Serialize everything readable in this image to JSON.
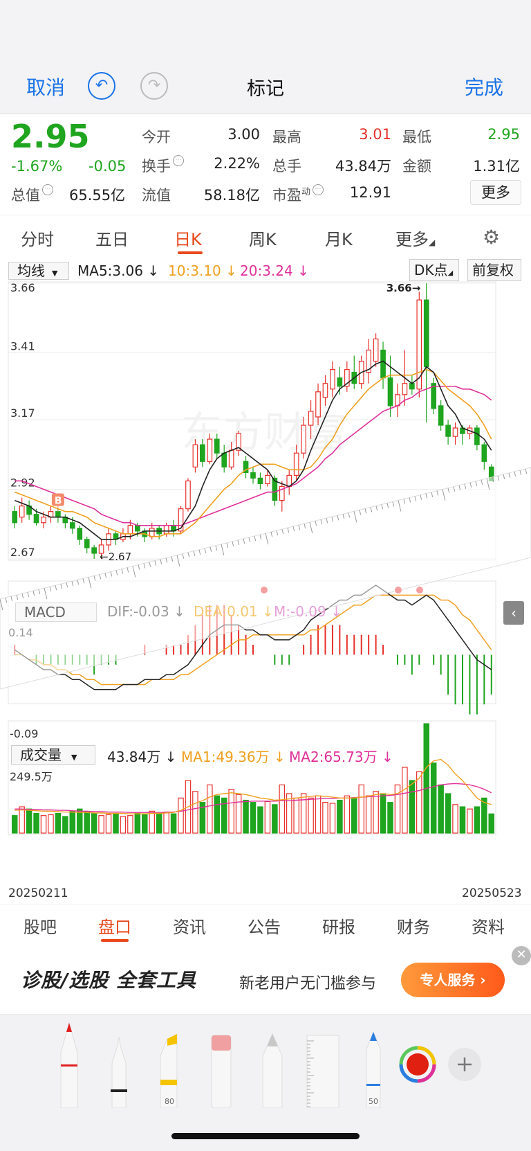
{
  "markup": {
    "cancel": "取消",
    "title": "标记",
    "done": "完成",
    "undo_icon": "undo-icon",
    "redo_icon": "redo-icon"
  },
  "quote": {
    "price": "2.95",
    "change_pct": "-1.67%",
    "change_abs": "-0.05",
    "total_mktcap_label": "总值",
    "total_mktcap": "65.55亿",
    "open_label": "今开",
    "open": "3.00",
    "high_label": "最高",
    "high": "3.01",
    "low_label": "最低",
    "low": "2.95",
    "turnover_label": "换手",
    "turnover": "2.22%",
    "volume_label": "总手",
    "volume": "43.84万",
    "amount_label": "金额",
    "amount": "1.31亿",
    "float_label": "流值",
    "float_mktcap": "58.18亿",
    "pe_label": "市盈",
    "pe_sup": "动",
    "pe": "12.91",
    "more": "更多",
    "colors": {
      "down": "#1fa51f",
      "up": "#e8302a"
    }
  },
  "period_tabs": [
    "分时",
    "五日",
    "日K",
    "周K",
    "月K",
    "更多"
  ],
  "settings_icon": "gear-icon",
  "kline": {
    "indicator_select": "均线",
    "ma5": "MA5:3.06",
    "ma10": "10:3.10",
    "ma20": "20:3.24",
    "dk_button": "DK点",
    "adjust_button": "前复权",
    "y_ticks": [
      "3.66",
      "3.41",
      "3.17",
      "2.92",
      "2.67"
    ],
    "high_marker": "3.66",
    "low_marker": "2.67",
    "watermark": "东方财富",
    "signal_b": "B",
    "colors": {
      "ma5": "#222222",
      "ma10": "#f0a020",
      "ma20": "#e0309a",
      "up": "#e8302a",
      "down": "#1fa51f"
    }
  },
  "macd": {
    "label": "MACD",
    "dif": "DIF:-0.03",
    "dea": "DEA:0.01",
    "m": "M:-0.09",
    "y_top": "0.14",
    "y_bottom": "-0.09"
  },
  "volume_panel": {
    "label": "成交量",
    "value": "43.84万",
    "ma1": "MA1:49.36万",
    "ma2": "MA2:65.73万",
    "y_top": "249.5万",
    "date_start": "20250211",
    "date_end": "20250523"
  },
  "bottom_tabs": [
    "股吧",
    "盘口",
    "资讯",
    "公告",
    "研报",
    "财务",
    "资料"
  ],
  "ad": {
    "title": "诊股/选股 全套工具",
    "subtitle": "新老用户无门槛参与",
    "button": "专人服务 ›"
  },
  "tools": {
    "marker_width": "80",
    "pen_width": "50"
  },
  "chart_data": {
    "type": "candlestick",
    "x_start": "20250211",
    "x_end": "20250523",
    "ylim": [
      2.67,
      3.66
    ],
    "candles": [
      [
        2.84,
        2.8,
        2.86,
        2.78
      ],
      [
        2.82,
        2.86,
        2.89,
        2.8
      ],
      [
        2.86,
        2.83,
        2.88,
        2.81
      ],
      [
        2.83,
        2.8,
        2.85,
        2.79
      ],
      [
        2.8,
        2.82,
        2.84,
        2.78
      ],
      [
        2.82,
        2.84,
        2.86,
        2.8
      ],
      [
        2.84,
        2.82,
        2.85,
        2.8
      ],
      [
        2.82,
        2.8,
        2.83,
        2.78
      ],
      [
        2.8,
        2.78,
        2.82,
        2.76
      ],
      [
        2.78,
        2.74,
        2.79,
        2.72
      ],
      [
        2.74,
        2.71,
        2.75,
        2.69
      ],
      [
        2.71,
        2.69,
        2.72,
        2.67
      ],
      [
        2.69,
        2.72,
        2.74,
        2.67
      ],
      [
        2.72,
        2.76,
        2.78,
        2.7
      ],
      [
        2.76,
        2.74,
        2.77,
        2.72
      ],
      [
        2.74,
        2.76,
        2.78,
        2.73
      ],
      [
        2.76,
        2.79,
        2.81,
        2.74
      ],
      [
        2.79,
        2.77,
        2.8,
        2.75
      ],
      [
        2.77,
        2.75,
        2.78,
        2.73
      ],
      [
        2.75,
        2.78,
        2.8,
        2.74
      ],
      [
        2.78,
        2.76,
        2.79,
        2.74
      ],
      [
        2.76,
        2.79,
        2.8,
        2.75
      ],
      [
        2.79,
        2.77,
        2.81,
        2.75
      ],
      [
        2.77,
        2.85,
        2.86,
        2.76
      ],
      [
        2.85,
        2.95,
        2.96,
        2.84
      ],
      [
        3.0,
        3.08,
        3.1,
        2.98
      ],
      [
        3.08,
        3.02,
        3.1,
        3.0
      ],
      [
        3.02,
        3.1,
        3.12,
        3.01
      ],
      [
        3.1,
        3.05,
        3.12,
        3.03
      ],
      [
        3.05,
        3.0,
        3.08,
        2.98
      ],
      [
        3.0,
        3.06,
        3.09,
        2.99
      ],
      [
        3.06,
        3.12,
        3.13,
        3.04
      ],
      [
        3.02,
        2.98,
        3.04,
        2.96
      ],
      [
        2.98,
        2.96,
        3.0,
        2.94
      ],
      [
        2.96,
        2.94,
        2.98,
        2.92
      ],
      [
        2.94,
        2.97,
        2.99,
        2.93
      ],
      [
        2.96,
        2.88,
        2.97,
        2.86
      ],
      [
        2.88,
        2.93,
        2.95,
        2.84
      ],
      [
        2.93,
        2.97,
        2.99,
        2.9
      ],
      [
        2.97,
        3.05,
        3.08,
        2.95
      ],
      [
        3.05,
        3.15,
        3.18,
        3.03
      ],
      [
        3.15,
        3.2,
        3.24,
        3.1
      ],
      [
        3.18,
        3.27,
        3.3,
        3.15
      ],
      [
        3.25,
        3.3,
        3.33,
        3.22
      ],
      [
        3.28,
        3.35,
        3.38,
        3.25
      ],
      [
        3.32,
        3.29,
        3.36,
        3.26
      ],
      [
        3.29,
        3.35,
        3.38,
        3.27
      ],
      [
        3.34,
        3.3,
        3.4,
        3.28
      ],
      [
        3.3,
        3.38,
        3.4,
        3.28
      ],
      [
        3.34,
        3.42,
        3.46,
        3.3
      ],
      [
        3.38,
        3.46,
        3.48,
        3.36
      ],
      [
        3.42,
        3.32,
        3.45,
        3.28
      ],
      [
        3.32,
        3.22,
        3.4,
        3.18
      ],
      [
        3.22,
        3.26,
        3.3,
        3.18
      ],
      [
        3.26,
        3.3,
        3.42,
        3.22
      ],
      [
        3.3,
        3.28,
        3.33,
        3.26
      ],
      [
        3.28,
        3.6,
        3.63,
        3.25
      ],
      [
        3.6,
        3.36,
        3.66,
        3.16
      ],
      [
        3.3,
        3.21,
        3.32,
        3.19
      ],
      [
        3.22,
        3.15,
        3.24,
        3.13
      ],
      [
        3.15,
        3.11,
        3.17,
        3.08
      ],
      [
        3.11,
        3.14,
        3.16,
        3.08
      ],
      [
        3.14,
        3.12,
        3.15,
        3.08
      ],
      [
        3.12,
        3.14,
        3.15,
        3.1
      ],
      [
        3.14,
        3.08,
        3.15,
        3.06
      ],
      [
        3.08,
        3.02,
        3.09,
        2.99
      ],
      [
        3.0,
        2.95,
        3.01,
        2.95
      ]
    ],
    "ma": {
      "ma5": [
        2.88,
        2.87,
        2.86,
        2.84,
        2.83,
        2.82,
        2.82,
        2.82,
        2.81,
        2.8,
        2.78,
        2.76,
        2.74,
        2.74,
        2.74,
        2.75,
        2.75,
        2.76,
        2.77,
        2.77,
        2.77,
        2.77,
        2.77,
        2.78,
        2.82,
        2.86,
        2.93,
        2.99,
        3.03,
        3.05,
        3.06,
        3.07,
        3.05,
        3.03,
        3.01,
        2.99,
        2.95,
        2.94,
        2.93,
        2.95,
        2.99,
        3.06,
        3.12,
        3.18,
        3.24,
        3.28,
        3.3,
        3.32,
        3.34,
        3.35,
        3.37,
        3.38,
        3.36,
        3.34,
        3.32,
        3.3,
        3.32,
        3.36,
        3.34,
        3.28,
        3.22,
        3.19,
        3.14,
        3.13,
        3.12,
        3.1,
        3.06
      ],
      "ma10": [
        2.91,
        2.9,
        2.89,
        2.88,
        2.87,
        2.86,
        2.85,
        2.84,
        2.84,
        2.83,
        2.82,
        2.8,
        2.79,
        2.78,
        2.77,
        2.76,
        2.76,
        2.76,
        2.76,
        2.75,
        2.75,
        2.76,
        2.76,
        2.76,
        2.78,
        2.8,
        2.83,
        2.86,
        2.89,
        2.92,
        2.94,
        2.97,
        2.99,
        3.0,
        3.01,
        3.01,
        3.01,
        3.0,
        2.99,
        2.99,
        2.99,
        3.0,
        3.03,
        3.07,
        3.1,
        3.15,
        3.19,
        3.22,
        3.25,
        3.28,
        3.3,
        3.32,
        3.33,
        3.33,
        3.33,
        3.33,
        3.34,
        3.35,
        3.34,
        3.31,
        3.28,
        3.26,
        3.24,
        3.22,
        3.19,
        3.15,
        3.1
      ],
      "ma20": [
        2.95,
        2.95,
        2.94,
        2.93,
        2.92,
        2.91,
        2.9,
        2.89,
        2.88,
        2.87,
        2.86,
        2.85,
        2.83,
        2.82,
        2.81,
        2.8,
        2.8,
        2.79,
        2.79,
        2.79,
        2.79,
        2.79,
        2.79,
        2.79,
        2.8,
        2.81,
        2.82,
        2.83,
        2.84,
        2.85,
        2.86,
        2.87,
        2.88,
        2.89,
        2.9,
        2.91,
        2.91,
        2.92,
        2.93,
        2.94,
        2.96,
        2.98,
        3.0,
        3.03,
        3.05,
        3.08,
        3.1,
        3.12,
        3.14,
        3.16,
        3.18,
        3.2,
        3.21,
        3.22,
        3.24,
        3.25,
        3.27,
        3.28,
        3.29,
        3.29,
        3.29,
        3.29,
        3.28,
        3.28,
        3.27,
        3.26,
        3.24
      ]
    },
    "macd": {
      "dif": [
        0.01,
        0.0,
        -0.01,
        -0.02,
        -0.03,
        -0.03,
        -0.04,
        -0.04,
        -0.05,
        -0.05,
        -0.06,
        -0.07,
        -0.07,
        -0.07,
        -0.07,
        -0.06,
        -0.06,
        -0.06,
        -0.05,
        -0.05,
        -0.05,
        -0.04,
        -0.04,
        -0.03,
        -0.02,
        0.0,
        0.02,
        0.04,
        0.05,
        0.06,
        0.06,
        0.06,
        0.05,
        0.05,
        0.04,
        0.04,
        0.03,
        0.03,
        0.03,
        0.04,
        0.05,
        0.07,
        0.08,
        0.09,
        0.1,
        0.11,
        0.11,
        0.12,
        0.12,
        0.13,
        0.14,
        0.13,
        0.12,
        0.11,
        0.11,
        0.1,
        0.11,
        0.12,
        0.11,
        0.09,
        0.07,
        0.05,
        0.03,
        0.01,
        -0.01,
        -0.02,
        -0.03
      ],
      "dea": [
        0.0,
        0.0,
        -0.01,
        -0.01,
        -0.02,
        -0.02,
        -0.03,
        -0.03,
        -0.04,
        -0.04,
        -0.05,
        -0.05,
        -0.06,
        -0.06,
        -0.06,
        -0.06,
        -0.06,
        -0.06,
        -0.06,
        -0.05,
        -0.05,
        -0.05,
        -0.05,
        -0.04,
        -0.04,
        -0.03,
        -0.02,
        -0.01,
        0.0,
        0.01,
        0.02,
        0.03,
        0.03,
        0.04,
        0.04,
        0.04,
        0.04,
        0.04,
        0.04,
        0.04,
        0.04,
        0.05,
        0.05,
        0.06,
        0.07,
        0.08,
        0.09,
        0.1,
        0.1,
        0.11,
        0.12,
        0.12,
        0.12,
        0.12,
        0.12,
        0.12,
        0.12,
        0.12,
        0.12,
        0.11,
        0.11,
        0.1,
        0.08,
        0.07,
        0.05,
        0.03,
        0.01
      ],
      "ylim": [
        -0.09,
        0.14
      ]
    },
    "volume": {
      "values": [
        40,
        60,
        55,
        45,
        40,
        42,
        45,
        38,
        50,
        55,
        48,
        45,
        40,
        42,
        45,
        38,
        40,
        45,
        42,
        50,
        45,
        48,
        44,
        80,
        120,
        95,
        70,
        110,
        85,
        80,
        100,
        88,
        75,
        70,
        60,
        72,
        65,
        110,
        90,
        80,
        90,
        80,
        85,
        70,
        68,
        75,
        85,
        80,
        110,
        85,
        95,
        90,
        70,
        110,
        150,
        120,
        140,
        249.5,
        160,
        110,
        90,
        65,
        60,
        55,
        60,
        80,
        43.84
      ],
      "ma1": [
        52,
        53,
        52,
        51,
        50,
        50,
        49,
        48,
        48,
        47,
        47,
        46,
        46,
        45,
        45,
        45,
        44,
        44,
        44,
        45,
        45,
        46,
        47,
        52,
        60,
        68,
        74,
        82,
        88,
        90,
        92,
        90,
        88,
        84,
        80,
        78,
        75,
        76,
        78,
        80,
        82,
        84,
        85,
        84,
        82,
        80,
        80,
        80,
        82,
        84,
        88,
        90,
        88,
        90,
        100,
        112,
        125,
        150,
        165,
        168,
        155,
        135,
        120,
        100,
        80,
        70,
        65
      ],
      "ma2": [
        55,
        55,
        54,
        54,
        53,
        53,
        52,
        52,
        51,
        50,
        50,
        49,
        49,
        48,
        48,
        48,
        47,
        47,
        47,
        47,
        47,
        48,
        48,
        50,
        53,
        56,
        59,
        62,
        65,
        67,
        69,
        71,
        72,
        73,
        73,
        73,
        73,
        74,
        74,
        75,
        76,
        77,
        78,
        79,
        79,
        80,
        80,
        81,
        82,
        83,
        84,
        85,
        86,
        88,
        91,
        94,
        97,
        102,
        106,
        110,
        112,
        113,
        112,
        110,
        106,
        100,
        92
      ],
      "ylim": [
        0,
        249.5
      ]
    }
  }
}
